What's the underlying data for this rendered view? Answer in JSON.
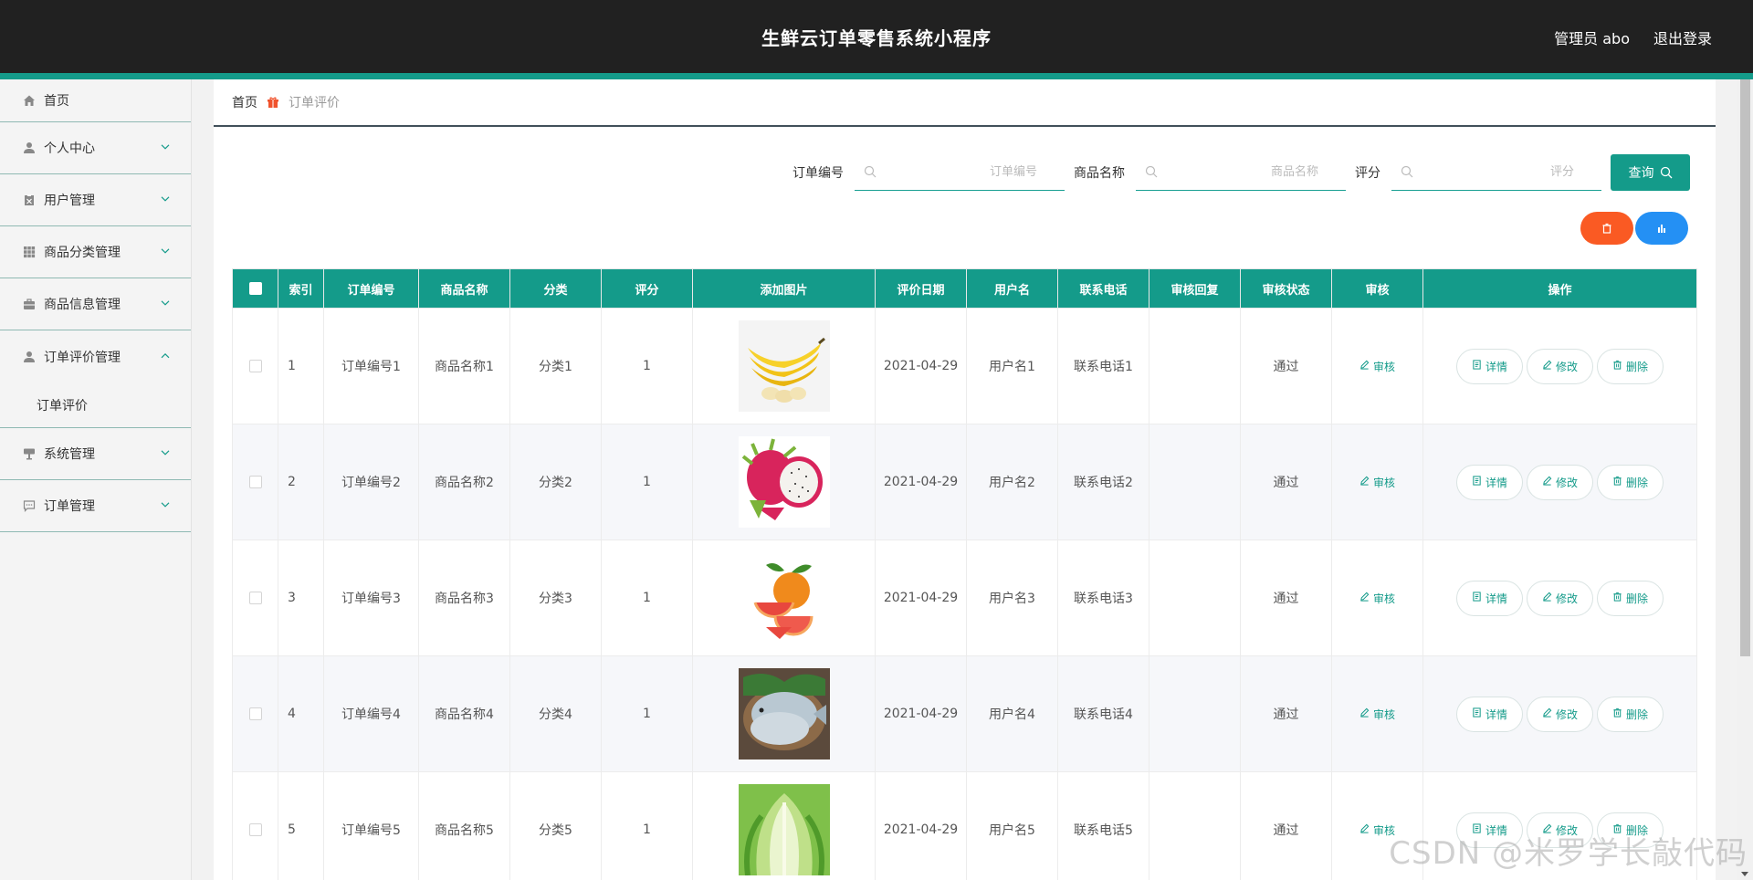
{
  "header": {
    "title": "生鲜云订单零售系统小程序",
    "user_label": "管理员 abo",
    "logout_label": "退出登录"
  },
  "sidebar": {
    "items": [
      {
        "label": "首页",
        "icon": "home-icon"
      },
      {
        "label": "个人中心",
        "icon": "user-icon"
      },
      {
        "label": "用户管理",
        "icon": "clipboard-icon"
      },
      {
        "label": "商品分类管理",
        "icon": "grid-icon"
      },
      {
        "label": "商品信息管理",
        "icon": "briefcase-icon"
      },
      {
        "label": "订单评价管理",
        "icon": "user-icon",
        "open": true
      },
      {
        "label": "系统管理",
        "icon": "sign-icon"
      },
      {
        "label": "订单管理",
        "icon": "chat-icon"
      }
    ],
    "submenu_label": "订单评价"
  },
  "breadcrumb": {
    "home": "首页",
    "current": "订单评价"
  },
  "search": {
    "order_no_label": "订单编号",
    "order_no_placeholder": "订单编号",
    "product_label": "商品名称",
    "product_placeholder": "商品名称",
    "score_label": "评分",
    "score_placeholder": "评分",
    "query_label": "查询"
  },
  "table": {
    "headers": [
      "索引",
      "订单编号",
      "商品名称",
      "分类",
      "评分",
      "添加图片",
      "评价日期",
      "用户名",
      "联系电话",
      "审核回复",
      "审核状态",
      "审核",
      "操作"
    ],
    "audit_label": "审核",
    "detail_label": "详情",
    "edit_label": "修改",
    "delete_label": "删除",
    "rows": [
      {
        "index": "1",
        "order_no": "订单编号1",
        "product": "商品名称1",
        "category": "分类1",
        "score": "1",
        "image": "banana",
        "date": "2021-04-29",
        "username": "用户名1",
        "phone": "联系电话1",
        "reply": "",
        "status": "通过"
      },
      {
        "index": "2",
        "order_no": "订单编号2",
        "product": "商品名称2",
        "category": "分类2",
        "score": "1",
        "image": "dragonfruit",
        "date": "2021-04-29",
        "username": "用户名2",
        "phone": "联系电话2",
        "reply": "",
        "status": "通过"
      },
      {
        "index": "3",
        "order_no": "订单编号3",
        "product": "商品名称3",
        "category": "分类3",
        "score": "1",
        "image": "grapefruit",
        "date": "2021-04-29",
        "username": "用户名3",
        "phone": "联系电话3",
        "reply": "",
        "status": "通过"
      },
      {
        "index": "4",
        "order_no": "订单编号4",
        "product": "商品名称4",
        "category": "分类4",
        "score": "1",
        "image": "fish",
        "date": "2021-04-29",
        "username": "用户名4",
        "phone": "联系电话4",
        "reply": "",
        "status": "通过"
      },
      {
        "index": "5",
        "order_no": "订单编号5",
        "product": "商品名称5",
        "category": "分类5",
        "score": "1",
        "image": "cabbage",
        "date": "2021-04-29",
        "username": "用户名5",
        "phone": "联系电话5",
        "reply": "",
        "status": "通过"
      }
    ]
  },
  "watermark": "CSDN @米罗学长敲代码",
  "colors": {
    "accent": "#149b8a",
    "topbar": "#212121",
    "delete_pill": "#fa5a23",
    "chart_pill": "#2490f4"
  }
}
